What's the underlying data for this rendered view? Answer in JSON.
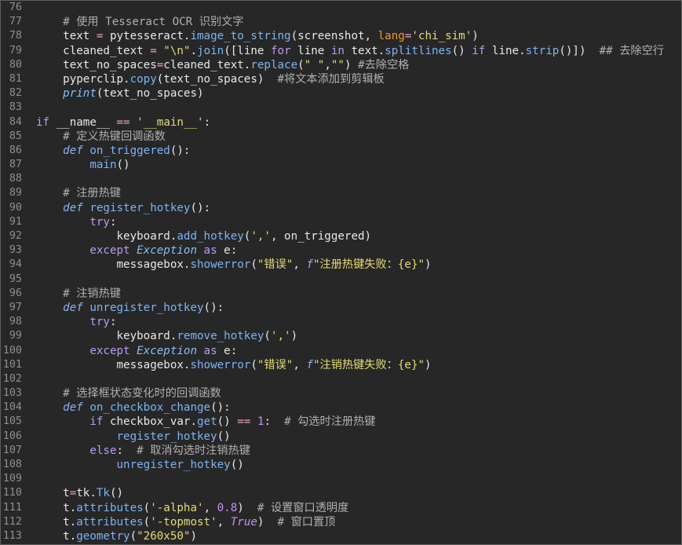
{
  "colors": {
    "background": "#272727",
    "text": "#e8e8e8",
    "line_number": "#8f8f8f",
    "comment": "#b0b0b0",
    "keyword": "#b99cf5",
    "storage": "#8fb0f5",
    "function": "#7cb4f5",
    "builtin": "#86bff2",
    "string": "#e6db74",
    "number": "#c792ea",
    "operator": "#f0a0c0",
    "argument": "#fd971f"
  },
  "editor": {
    "lines": [
      {
        "number": "76",
        "tokens": []
      },
      {
        "number": "77",
        "tokens": [
          [
            "    # 使用 Tesseract OCR 识别文字",
            "#b0b0b0"
          ]
        ]
      },
      {
        "number": "78",
        "tokens": [
          [
            "    text ",
            "#e8e8e8"
          ],
          [
            "=",
            "#f0a0c0"
          ],
          [
            " pytesseract.",
            "#e8e8e8"
          ],
          [
            "image_to_string",
            "#7cb4f5"
          ],
          [
            "(screenshot, ",
            "#e8e8e8"
          ],
          [
            "lang",
            "#fd971f"
          ],
          [
            "=",
            "#f0a0c0"
          ],
          [
            "'chi_sim'",
            "#e6db74"
          ],
          [
            ")",
            "#e8e8e8"
          ]
        ]
      },
      {
        "number": "79",
        "tokens": [
          [
            "    cleaned_text ",
            "#e8e8e8"
          ],
          [
            "=",
            "#f0a0c0"
          ],
          [
            " \"\\n\"",
            "#e6db74"
          ],
          [
            ".",
            "#e8e8e8"
          ],
          [
            "join",
            "#7cb4f5"
          ],
          [
            "([line ",
            "#e8e8e8"
          ],
          [
            "for",
            "#b99cf5"
          ],
          [
            " line ",
            "#e8e8e8"
          ],
          [
            "in",
            "#b99cf5"
          ],
          [
            " text.",
            "#e8e8e8"
          ],
          [
            "splitlines",
            "#7cb4f5"
          ],
          [
            "() ",
            "#e8e8e8"
          ],
          [
            "if",
            "#b99cf5"
          ],
          [
            " line.",
            "#e8e8e8"
          ],
          [
            "strip",
            "#7cb4f5"
          ],
          [
            "()])  ",
            "#e8e8e8"
          ],
          [
            "## 去除空行",
            "#b0b0b0"
          ]
        ]
      },
      {
        "number": "80",
        "tokens": [
          [
            "    text_no_spaces",
            "#e8e8e8"
          ],
          [
            "=",
            "#f0a0c0"
          ],
          [
            "cleaned_text.",
            "#e8e8e8"
          ],
          [
            "replace",
            "#7cb4f5"
          ],
          [
            "(",
            "#e8e8e8"
          ],
          [
            "\" \"",
            "#e6db74"
          ],
          [
            ",",
            "#e8e8e8"
          ],
          [
            "\"\"",
            "#e6db74"
          ],
          [
            ") ",
            "#e8e8e8"
          ],
          [
            "#去除空格",
            "#b0b0b0"
          ]
        ]
      },
      {
        "number": "81",
        "tokens": [
          [
            "    pyperclip.",
            "#e8e8e8"
          ],
          [
            "copy",
            "#7cb4f5"
          ],
          [
            "(text_no_spaces)  ",
            "#e8e8e8"
          ],
          [
            "#将文本添加到剪辑板",
            "#b0b0b0"
          ]
        ]
      },
      {
        "number": "82",
        "tokens": [
          [
            "    print",
            "#86bff2",
            true
          ],
          [
            "(text_no_spaces)",
            "#e8e8e8"
          ]
        ]
      },
      {
        "number": "83",
        "tokens": []
      },
      {
        "number": "84",
        "tokens": [
          [
            "if",
            "#b99cf5"
          ],
          [
            " __name__ ",
            "#e8e8e8"
          ],
          [
            "==",
            "#f0a0c0"
          ],
          [
            " '__main__'",
            "#e6db74"
          ],
          [
            ":",
            "#e8e8e8"
          ]
        ]
      },
      {
        "number": "85",
        "tokens": [
          [
            "    # 定义热键回调函数",
            "#b0b0b0"
          ]
        ]
      },
      {
        "number": "86",
        "tokens": [
          [
            "    def",
            "#8fb0f5",
            true
          ],
          [
            " on_triggered",
            "#7cb4f5"
          ],
          [
            "():",
            "#e8e8e8"
          ]
        ]
      },
      {
        "number": "87",
        "tokens": [
          [
            "        main",
            "#7cb4f5"
          ],
          [
            "()",
            "#e8e8e8"
          ]
        ]
      },
      {
        "number": "88",
        "tokens": []
      },
      {
        "number": "89",
        "tokens": [
          [
            "    # 注册热键",
            "#b0b0b0"
          ]
        ]
      },
      {
        "number": "90",
        "tokens": [
          [
            "    def",
            "#8fb0f5",
            true
          ],
          [
            " register_hotkey",
            "#7cb4f5"
          ],
          [
            "():",
            "#e8e8e8"
          ]
        ]
      },
      {
        "number": "91",
        "tokens": [
          [
            "        try",
            "#b99cf5"
          ],
          [
            ":",
            "#e8e8e8"
          ]
        ]
      },
      {
        "number": "92",
        "tokens": [
          [
            "            keyboard.",
            "#e8e8e8"
          ],
          [
            "add_hotkey",
            "#7cb4f5"
          ],
          [
            "(",
            "#e8e8e8"
          ],
          [
            "','",
            "#e6db74"
          ],
          [
            ", on_triggered)",
            "#e8e8e8"
          ]
        ]
      },
      {
        "number": "93",
        "tokens": [
          [
            "        except",
            "#b99cf5"
          ],
          [
            " Exception",
            "#86bff2",
            true
          ],
          [
            " as",
            "#b99cf5"
          ],
          [
            " e:",
            "#e8e8e8"
          ]
        ]
      },
      {
        "number": "94",
        "tokens": [
          [
            "            messagebox.",
            "#e8e8e8"
          ],
          [
            "showerror",
            "#7cb4f5"
          ],
          [
            "(",
            "#e8e8e8"
          ],
          [
            "\"错误\"",
            "#e6db74"
          ],
          [
            ", ",
            "#e8e8e8"
          ],
          [
            "f",
            "#8fb0f5",
            true
          ],
          [
            "\"注册热键失败：{e}\"",
            "#e6db74"
          ],
          [
            ")",
            "#e8e8e8"
          ]
        ]
      },
      {
        "number": "95",
        "tokens": []
      },
      {
        "number": "96",
        "tokens": [
          [
            "    # 注销热键",
            "#b0b0b0"
          ]
        ]
      },
      {
        "number": "97",
        "tokens": [
          [
            "    def",
            "#8fb0f5",
            true
          ],
          [
            " unregister_hotkey",
            "#7cb4f5"
          ],
          [
            "():",
            "#e8e8e8"
          ]
        ]
      },
      {
        "number": "98",
        "tokens": [
          [
            "        try",
            "#b99cf5"
          ],
          [
            ":",
            "#e8e8e8"
          ]
        ]
      },
      {
        "number": "99",
        "tokens": [
          [
            "            keyboard.",
            "#e8e8e8"
          ],
          [
            "remove_hotkey",
            "#7cb4f5"
          ],
          [
            "(",
            "#e8e8e8"
          ],
          [
            "','",
            "#e6db74"
          ],
          [
            ")",
            "#e8e8e8"
          ]
        ]
      },
      {
        "number": "100",
        "tokens": [
          [
            "        except",
            "#b99cf5"
          ],
          [
            " Exception",
            "#86bff2",
            true
          ],
          [
            " as",
            "#b99cf5"
          ],
          [
            " e:",
            "#e8e8e8"
          ]
        ]
      },
      {
        "number": "101",
        "tokens": [
          [
            "            messagebox.",
            "#e8e8e8"
          ],
          [
            "showerror",
            "#7cb4f5"
          ],
          [
            "(",
            "#e8e8e8"
          ],
          [
            "\"错误\"",
            "#e6db74"
          ],
          [
            ", ",
            "#e8e8e8"
          ],
          [
            "f",
            "#8fb0f5",
            true
          ],
          [
            "\"注销热键失败：{e}\"",
            "#e6db74"
          ],
          [
            ")",
            "#e8e8e8"
          ]
        ]
      },
      {
        "number": "102",
        "tokens": []
      },
      {
        "number": "103",
        "tokens": [
          [
            "    # 选择框状态变化时的回调函数",
            "#b0b0b0"
          ]
        ]
      },
      {
        "number": "104",
        "tokens": [
          [
            "    def",
            "#8fb0f5",
            true
          ],
          [
            " on_checkbox_change",
            "#7cb4f5"
          ],
          [
            "():",
            "#e8e8e8"
          ]
        ]
      },
      {
        "number": "105",
        "tokens": [
          [
            "        if",
            "#b99cf5"
          ],
          [
            " checkbox_var.",
            "#e8e8e8"
          ],
          [
            "get",
            "#7cb4f5"
          ],
          [
            "() ",
            "#e8e8e8"
          ],
          [
            "==",
            "#f0a0c0"
          ],
          [
            " 1",
            "#c792ea"
          ],
          [
            ":  ",
            "#e8e8e8"
          ],
          [
            "# 勾选时注册热键",
            "#b0b0b0"
          ]
        ]
      },
      {
        "number": "106",
        "tokens": [
          [
            "            register_hotkey",
            "#7cb4f5"
          ],
          [
            "()",
            "#e8e8e8"
          ]
        ]
      },
      {
        "number": "107",
        "tokens": [
          [
            "        else",
            "#b99cf5"
          ],
          [
            ":  ",
            "#e8e8e8"
          ],
          [
            "# 取消勾选时注销热键",
            "#b0b0b0"
          ]
        ]
      },
      {
        "number": "108",
        "tokens": [
          [
            "            unregister_hotkey",
            "#7cb4f5"
          ],
          [
            "()",
            "#e8e8e8"
          ]
        ]
      },
      {
        "number": "109",
        "tokens": []
      },
      {
        "number": "110",
        "tokens": [
          [
            "    t",
            "#e8e8e8"
          ],
          [
            "=",
            "#f0a0c0"
          ],
          [
            "tk.",
            "#e8e8e8"
          ],
          [
            "Tk",
            "#7cb4f5"
          ],
          [
            "()",
            "#e8e8e8"
          ]
        ]
      },
      {
        "number": "111",
        "tokens": [
          [
            "    t.",
            "#e8e8e8"
          ],
          [
            "attributes",
            "#7cb4f5"
          ],
          [
            "(",
            "#e8e8e8"
          ],
          [
            "'-alpha'",
            "#e6db74"
          ],
          [
            ", ",
            "#e8e8e8"
          ],
          [
            "0.8",
            "#c792ea"
          ],
          [
            ")  ",
            "#e8e8e8"
          ],
          [
            "# 设置窗口透明度",
            "#b0b0b0"
          ]
        ]
      },
      {
        "number": "112",
        "tokens": [
          [
            "    t.",
            "#e8e8e8"
          ],
          [
            "attributes",
            "#7cb4f5"
          ],
          [
            "(",
            "#e8e8e8"
          ],
          [
            "'-topmost'",
            "#e6db74"
          ],
          [
            ", ",
            "#e8e8e8"
          ],
          [
            "True",
            "#c792ea",
            true
          ],
          [
            ")  ",
            "#e8e8e8"
          ],
          [
            "# 窗口置顶",
            "#b0b0b0"
          ]
        ]
      },
      {
        "number": "113",
        "tokens": [
          [
            "    t.",
            "#e8e8e8"
          ],
          [
            "geometry",
            "#7cb4f5"
          ],
          [
            "(",
            "#e8e8e8"
          ],
          [
            "\"260x50\"",
            "#e6db74"
          ],
          [
            ")",
            "#e8e8e8"
          ]
        ]
      }
    ]
  }
}
